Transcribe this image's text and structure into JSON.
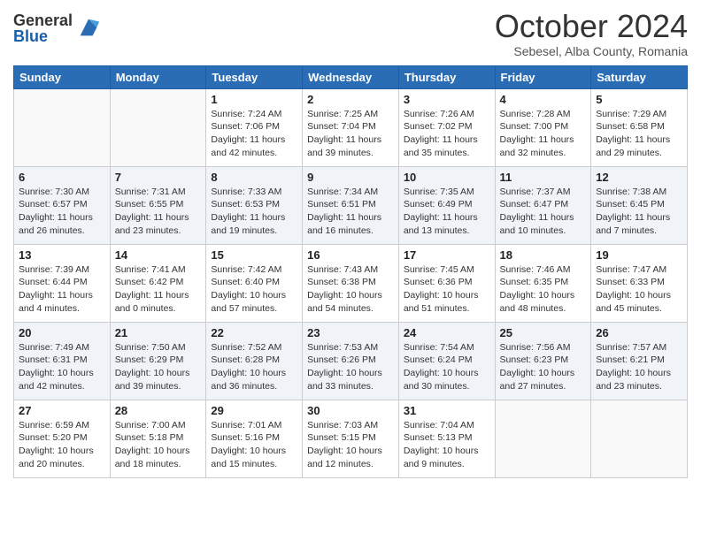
{
  "header": {
    "logo_general": "General",
    "logo_blue": "Blue",
    "month_title": "October 2024",
    "subtitle": "Sebesel, Alba County, Romania"
  },
  "days_of_week": [
    "Sunday",
    "Monday",
    "Tuesday",
    "Wednesday",
    "Thursday",
    "Friday",
    "Saturday"
  ],
  "weeks": [
    [
      {
        "day": "",
        "info": ""
      },
      {
        "day": "",
        "info": ""
      },
      {
        "day": "1",
        "info": "Sunrise: 7:24 AM\nSunset: 7:06 PM\nDaylight: 11 hours and 42 minutes."
      },
      {
        "day": "2",
        "info": "Sunrise: 7:25 AM\nSunset: 7:04 PM\nDaylight: 11 hours and 39 minutes."
      },
      {
        "day": "3",
        "info": "Sunrise: 7:26 AM\nSunset: 7:02 PM\nDaylight: 11 hours and 35 minutes."
      },
      {
        "day": "4",
        "info": "Sunrise: 7:28 AM\nSunset: 7:00 PM\nDaylight: 11 hours and 32 minutes."
      },
      {
        "day": "5",
        "info": "Sunrise: 7:29 AM\nSunset: 6:58 PM\nDaylight: 11 hours and 29 minutes."
      }
    ],
    [
      {
        "day": "6",
        "info": "Sunrise: 7:30 AM\nSunset: 6:57 PM\nDaylight: 11 hours and 26 minutes."
      },
      {
        "day": "7",
        "info": "Sunrise: 7:31 AM\nSunset: 6:55 PM\nDaylight: 11 hours and 23 minutes."
      },
      {
        "day": "8",
        "info": "Sunrise: 7:33 AM\nSunset: 6:53 PM\nDaylight: 11 hours and 19 minutes."
      },
      {
        "day": "9",
        "info": "Sunrise: 7:34 AM\nSunset: 6:51 PM\nDaylight: 11 hours and 16 minutes."
      },
      {
        "day": "10",
        "info": "Sunrise: 7:35 AM\nSunset: 6:49 PM\nDaylight: 11 hours and 13 minutes."
      },
      {
        "day": "11",
        "info": "Sunrise: 7:37 AM\nSunset: 6:47 PM\nDaylight: 11 hours and 10 minutes."
      },
      {
        "day": "12",
        "info": "Sunrise: 7:38 AM\nSunset: 6:45 PM\nDaylight: 11 hours and 7 minutes."
      }
    ],
    [
      {
        "day": "13",
        "info": "Sunrise: 7:39 AM\nSunset: 6:44 PM\nDaylight: 11 hours and 4 minutes."
      },
      {
        "day": "14",
        "info": "Sunrise: 7:41 AM\nSunset: 6:42 PM\nDaylight: 11 hours and 0 minutes."
      },
      {
        "day": "15",
        "info": "Sunrise: 7:42 AM\nSunset: 6:40 PM\nDaylight: 10 hours and 57 minutes."
      },
      {
        "day": "16",
        "info": "Sunrise: 7:43 AM\nSunset: 6:38 PM\nDaylight: 10 hours and 54 minutes."
      },
      {
        "day": "17",
        "info": "Sunrise: 7:45 AM\nSunset: 6:36 PM\nDaylight: 10 hours and 51 minutes."
      },
      {
        "day": "18",
        "info": "Sunrise: 7:46 AM\nSunset: 6:35 PM\nDaylight: 10 hours and 48 minutes."
      },
      {
        "day": "19",
        "info": "Sunrise: 7:47 AM\nSunset: 6:33 PM\nDaylight: 10 hours and 45 minutes."
      }
    ],
    [
      {
        "day": "20",
        "info": "Sunrise: 7:49 AM\nSunset: 6:31 PM\nDaylight: 10 hours and 42 minutes."
      },
      {
        "day": "21",
        "info": "Sunrise: 7:50 AM\nSunset: 6:29 PM\nDaylight: 10 hours and 39 minutes."
      },
      {
        "day": "22",
        "info": "Sunrise: 7:52 AM\nSunset: 6:28 PM\nDaylight: 10 hours and 36 minutes."
      },
      {
        "day": "23",
        "info": "Sunrise: 7:53 AM\nSunset: 6:26 PM\nDaylight: 10 hours and 33 minutes."
      },
      {
        "day": "24",
        "info": "Sunrise: 7:54 AM\nSunset: 6:24 PM\nDaylight: 10 hours and 30 minutes."
      },
      {
        "day": "25",
        "info": "Sunrise: 7:56 AM\nSunset: 6:23 PM\nDaylight: 10 hours and 27 minutes."
      },
      {
        "day": "26",
        "info": "Sunrise: 7:57 AM\nSunset: 6:21 PM\nDaylight: 10 hours and 23 minutes."
      }
    ],
    [
      {
        "day": "27",
        "info": "Sunrise: 6:59 AM\nSunset: 5:20 PM\nDaylight: 10 hours and 20 minutes."
      },
      {
        "day": "28",
        "info": "Sunrise: 7:00 AM\nSunset: 5:18 PM\nDaylight: 10 hours and 18 minutes."
      },
      {
        "day": "29",
        "info": "Sunrise: 7:01 AM\nSunset: 5:16 PM\nDaylight: 10 hours and 15 minutes."
      },
      {
        "day": "30",
        "info": "Sunrise: 7:03 AM\nSunset: 5:15 PM\nDaylight: 10 hours and 12 minutes."
      },
      {
        "day": "31",
        "info": "Sunrise: 7:04 AM\nSunset: 5:13 PM\nDaylight: 10 hours and 9 minutes."
      },
      {
        "day": "",
        "info": ""
      },
      {
        "day": "",
        "info": ""
      }
    ]
  ]
}
